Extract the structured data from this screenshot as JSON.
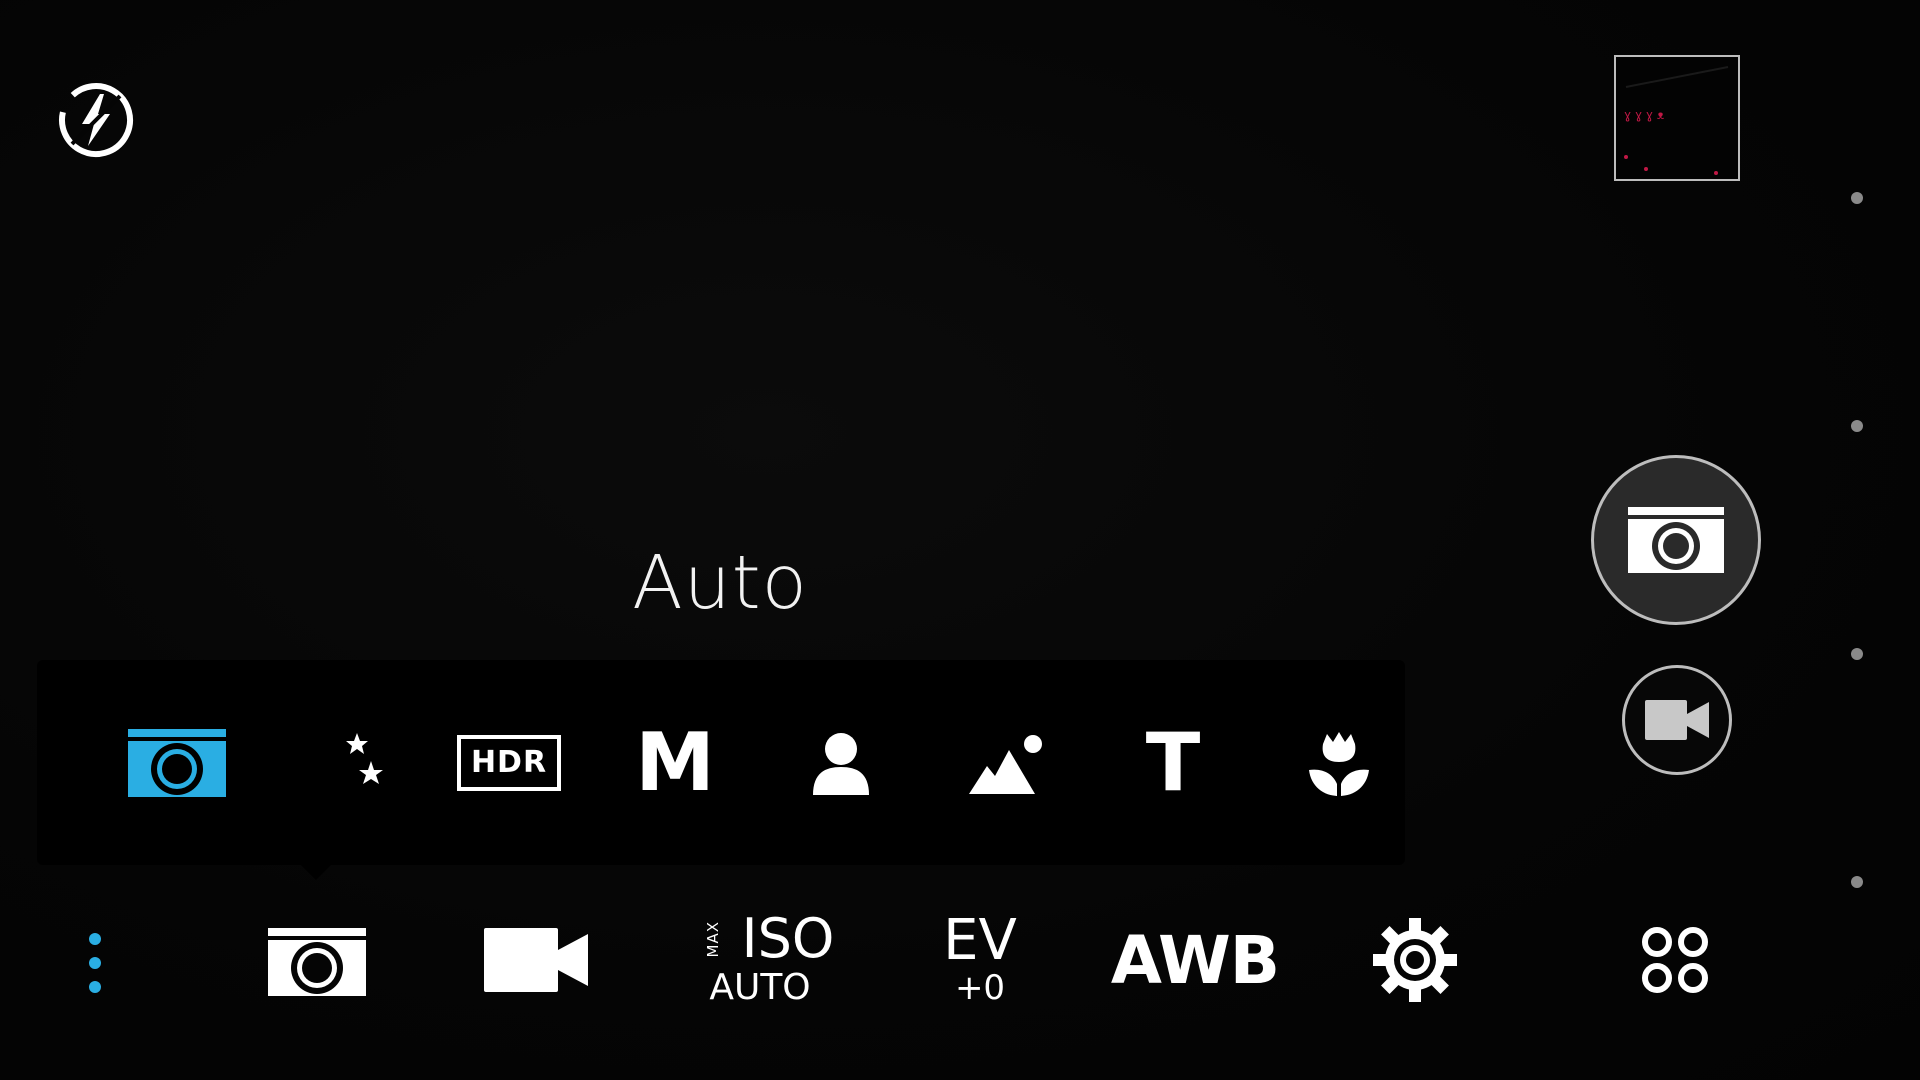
{
  "colors": {
    "accent": "#2aaee3",
    "icon": "#ffffff",
    "ring": "#bdbdbd",
    "panel": "#000000"
  },
  "top": {
    "flash_icon": "flash-off-icon",
    "gallery_icon": "gallery-thumbnail"
  },
  "capture": {
    "photo_icon": "camera-icon",
    "video_icon": "video-camera-icon"
  },
  "mode_selector": {
    "current_mode": "Auto",
    "modes": [
      {
        "name": "Auto",
        "icon": "camera-icon",
        "selected": true
      },
      {
        "name": "Night",
        "icon": "night-moon-icon",
        "selected": false
      },
      {
        "name": "HDR",
        "label": "HDR",
        "icon": "hdr-icon",
        "selected": false
      },
      {
        "name": "Manual",
        "label": "M",
        "icon": "manual-icon",
        "selected": false
      },
      {
        "name": "Portrait",
        "icon": "person-icon",
        "selected": false
      },
      {
        "name": "Landscape",
        "icon": "mountain-icon",
        "selected": false
      },
      {
        "name": "Text",
        "label": "T",
        "icon": "text-icon",
        "selected": false
      },
      {
        "name": "Macro",
        "icon": "flower-icon",
        "selected": false
      }
    ]
  },
  "toolbar": {
    "more_icon": "more-vertical-icon",
    "photo_mode_icon": "camera-icon",
    "video_mode_icon": "video-camera-icon",
    "iso": {
      "max_label": "MAX",
      "label": "ISO",
      "value": "AUTO"
    },
    "ev": {
      "label": "EV",
      "value": "+0"
    },
    "awb": {
      "label": "AWB"
    },
    "settings_icon": "gear-icon",
    "apps_icon": "grid-icon"
  }
}
